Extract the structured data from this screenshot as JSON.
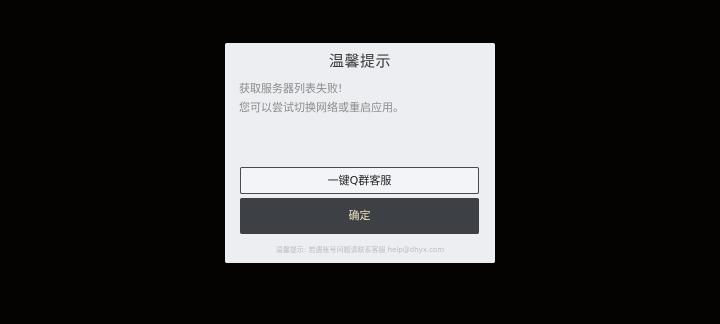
{
  "dialog": {
    "title": "温馨提示",
    "message_line1": "获取服务器列表失败!",
    "message_line2": "您可以尝试切换网络或重启应用。",
    "qq_group_button": "一键Q群客服",
    "confirm_button": "确定",
    "footer_note": "温馨提示: 若遇账号问题请联系客服 help@dhyx.com"
  },
  "colors": {
    "background": "#050202",
    "dialog_background": "#eceef2",
    "primary_button": "#3d4045",
    "primary_button_text": "#f1e2bf"
  }
}
